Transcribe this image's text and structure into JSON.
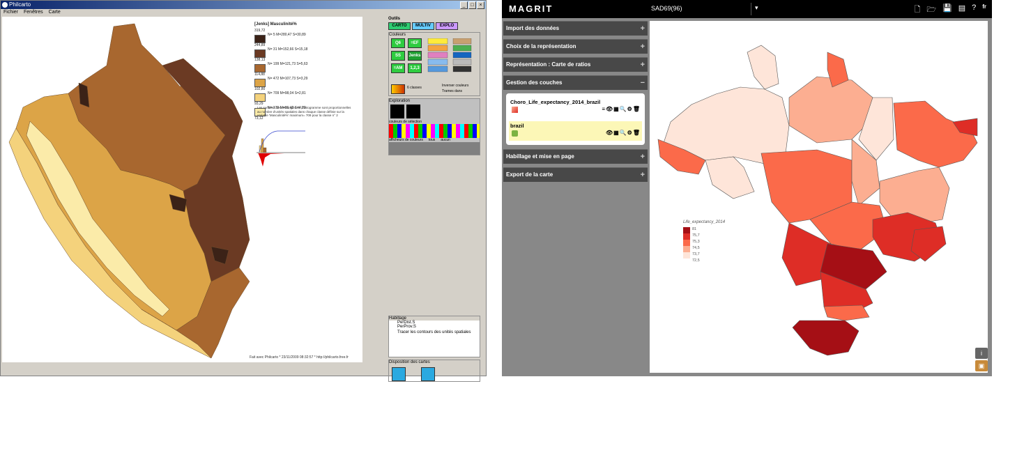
{
  "philcarto": {
    "title": "Philcarto",
    "menus": [
      "Fichier",
      "Fenêtres",
      "Carte"
    ],
    "legend": {
      "title": "[Jenks] Masculinité%",
      "bounds": [
        "319,72",
        "244,89",
        "138,13",
        "114,88",
        "102,80",
        "93,29",
        "73,12"
      ],
      "classes": [
        {
          "stats": "N= 5  M=280,47  S=30,89",
          "color": "#3b2217"
        },
        {
          "stats": "N= 31  M=152,66  S=15,18",
          "color": "#6b3a23"
        },
        {
          "stats": "N= 199  M=121,73  S=5,63",
          "color": "#a8672f"
        },
        {
          "stats": "N= 472  M=107,73  S=3,29",
          "color": "#dca447"
        },
        {
          "stats": "N= 709  M=98,04  S=2,81",
          "color": "#f4d27c"
        },
        {
          "stats": "N= 379  M=86,42  S=4,29",
          "color": "#fbeba9"
        }
      ],
      "note": "Les surfaces des rectangles de l'histogramme sont proportionnelles au nombre d'unités spatiales dans chaque classe définie sur la variable 'Masculinité%' maximum= 709 pour la classe n° 2"
    },
    "footer": "Fait avec Philcarto * 23/11/2009 08:32:57 * http://philcarto.free.fr",
    "tools": {
      "title": "Outils",
      "tabs": [
        "CARTO",
        "MULTIV",
        "EXPLO"
      ],
      "colors_label": "Couleurs",
      "method_buttons": [
        "Q6",
        "=EF",
        "SS",
        "Jenks",
        "=AM",
        "1,2,3"
      ],
      "classes_label": "6  classes",
      "invert_label": "Inverser couleurs",
      "trames_label": "Trames dans",
      "exploration_label": "Exploration",
      "selection_colors_label": "couleurs de sélection",
      "afficheurs_label": "afficheurs de couleurs",
      "tous_label": "tous",
      "aucun_label": "aucun",
      "habillage_label": "Habillage",
      "habillage_items": [
        "PerDist.S",
        "PerProv.S"
      ],
      "tracer_label": "Tracer les contours des unités spatiales",
      "disposition_label": "Disposition des cartes"
    }
  },
  "magrit": {
    "logo": "MAGRIT",
    "project": "SAD69(96)",
    "lang": "fr",
    "sections": [
      "Import des données",
      "Choix de la représentation",
      "Représentation : Carte de ratios",
      "Gestion des couches",
      "Habillage et mise en page",
      "Export de la carte"
    ],
    "layers": [
      {
        "name": "Choro_Life_expectancy_2014_brazil"
      },
      {
        "name": "brazil"
      }
    ],
    "legend": {
      "title": "Life_expectancy_2014",
      "bounds": [
        "81",
        "75,7",
        "75,3",
        "74,5",
        "73,7",
        "72,5"
      ],
      "colors": [
        "#a50f15",
        "#de2d26",
        "#fb6a4a",
        "#fcae91",
        "#fee5d9"
      ]
    },
    "buttons": {
      "info": "i",
      "lock": "🔒"
    }
  }
}
